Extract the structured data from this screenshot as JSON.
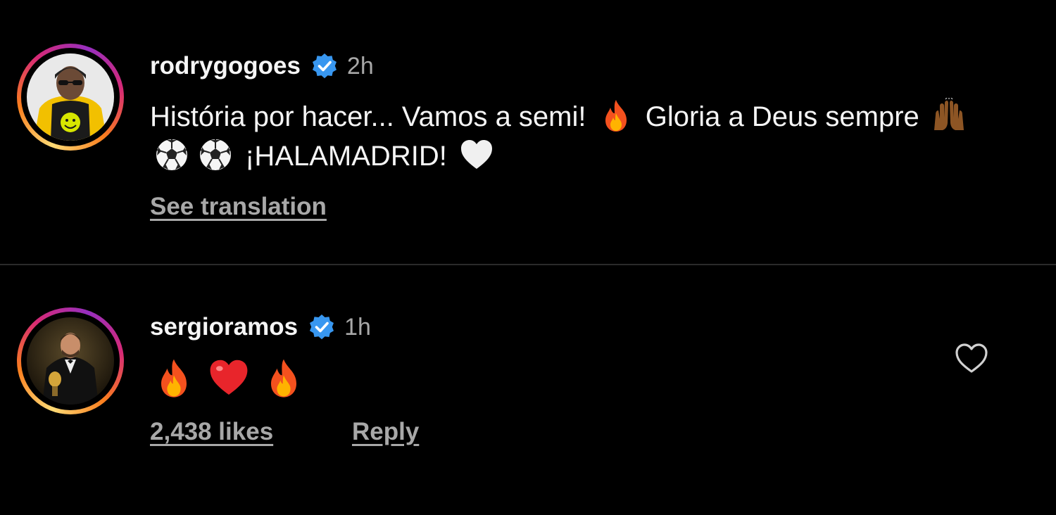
{
  "post": {
    "username": "rodrygogoes",
    "time": "2h",
    "caption_part1": "História por hacer... Vamos a semi! ",
    "caption_part2": " Gloria a Deus sempre ",
    "caption_part3": " ¡HALAMADRID! ",
    "emojis": [
      "fire-emoji",
      "raising-hands-emoji",
      "soccer-ball-emoji",
      "soccer-ball-emoji",
      "white-heart-emoji"
    ],
    "see_translation": "See translation"
  },
  "comment": {
    "username": "sergioramos",
    "time": "1h",
    "emojis": [
      "fire-emoji",
      "red-heart-emoji",
      "fire-emoji"
    ],
    "likes": "2,438 likes",
    "reply": "Reply"
  },
  "colors": {
    "background": "#000000",
    "text": "#f5f5f5",
    "secondary": "#a8a8a8",
    "verified": "#3897f0"
  }
}
